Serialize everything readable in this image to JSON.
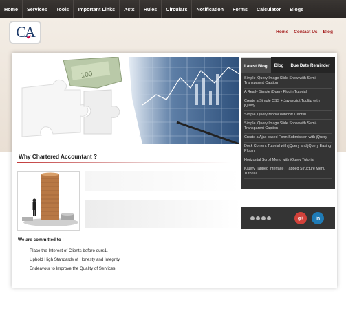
{
  "topnav": {
    "items": [
      "Home",
      "Services",
      "Tools",
      "Important Links",
      "Acts",
      "Rules",
      "Circulars",
      "Notification",
      "Forms",
      "Calculator",
      "Blogs"
    ]
  },
  "logo": {
    "text": "CA"
  },
  "header_links": [
    "Home",
    "Contact Us",
    "Blog"
  ],
  "blog_widget": {
    "tabs": [
      "Latest Blog",
      "Blog",
      "Due Date Reminder"
    ],
    "active_tab": "Latest Blog",
    "items": [
      "Simple jQuery Image Slide Show with Semi-Transparent Caption",
      "A Really Simple jQuery Plugin Tutorial",
      "Create a Simple CSS + Javascript Tooltip with jQuery",
      "Simple jQuery Modal Window Tutorial",
      "Simple jQuery Image Slide Show with Semi-Transparent Caption",
      "Create a Ajax based Form Submission with jQuery",
      "Dock Content Tutorial with jQuery and jQuery Easing Plugin",
      "Horizontal Scroll Menu with jQuery Tutorial",
      "jQuery Tabbed Interface / Tabbed Structure Menu Tutorial"
    ]
  },
  "section": {
    "title": "Why Chartered Accountant ?"
  },
  "social": {
    "gplus_label": "g+",
    "linkedin_label": "in"
  },
  "commitments": {
    "title": "We are committed to :",
    "items": [
      "Place the Interest of Clients before ours1.",
      "Uphold High Standards of Honesty and Integrity.",
      "Endeavour to Improve the Quality of Services"
    ]
  },
  "colors": {
    "nav_bg": "#2a2624",
    "link_red": "#a31a1a",
    "widget_bg": "#343434",
    "gplus": "#d2413a",
    "linkedin": "#1f7bb6"
  }
}
